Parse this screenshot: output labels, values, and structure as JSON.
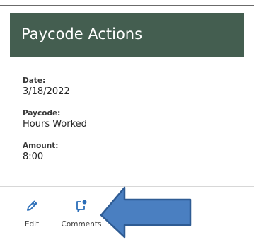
{
  "panel": {
    "title": "Paycode Actions",
    "header_color": "#445e50",
    "fields": {
      "date": {
        "label": "Date:",
        "value": "3/18/2022"
      },
      "paycode": {
        "label": "Paycode:",
        "value": "Hours Worked"
      },
      "amount": {
        "label": "Amount:",
        "value": "8:00"
      }
    }
  },
  "actions": {
    "edit": {
      "label": "Edit",
      "icon": "pencil-icon"
    },
    "comments": {
      "label": "Comments",
      "icon": "comment-add-icon"
    },
    "icon_color": "#2a6db8"
  },
  "annotation": {
    "arrow_color": "#4a7fc1",
    "arrow_outline": "#2e5b93"
  }
}
